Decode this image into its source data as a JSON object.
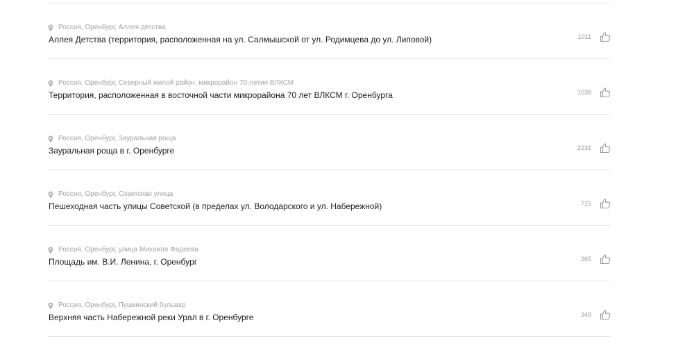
{
  "items": [
    {
      "location": "Россия, Оренбург, Аллея детства",
      "title": "Аллея Детства (территория, расположенная на ул. Салмышской от ул. Родимцева до ул. Липовой)",
      "votes": "1011"
    },
    {
      "location": "Россия, Оренбург, Северный жилой район, микрорайон 70-летия ВЛКСМ",
      "title": "Территория, расположенная в восточной части микрорайона 70 лет ВЛКСМ г. Оренбурга",
      "votes": "1038"
    },
    {
      "location": "Россия, Оренбург, Зауральная роща",
      "title": "Зауральная роща в г. Оренбурге",
      "votes": "2231"
    },
    {
      "location": "Россия, Оренбург, Советская улица",
      "title": "Пешеходная часть улицы Советской (в пределах ул. Володарского и ул. Набережной)",
      "votes": "715"
    },
    {
      "location": "Россия, Оренбург, улица Михаила Фадеева",
      "title": "Площадь им. В.И. Ленина, г. Оренбург",
      "votes": "265"
    },
    {
      "location": "Россия, Оренбург, Пушкинский бульвар",
      "title": "Верхняя часть Набережной реки Урал в г. Оренбурге",
      "votes": "349"
    }
  ],
  "icons": {
    "location": "location-pin-icon",
    "like": "thumbs-up-icon"
  },
  "colors": {
    "title": "#1d1d1d",
    "location": "#a3a3a3",
    "count": "#9a9a9a",
    "divider": "#e6e6e6"
  }
}
